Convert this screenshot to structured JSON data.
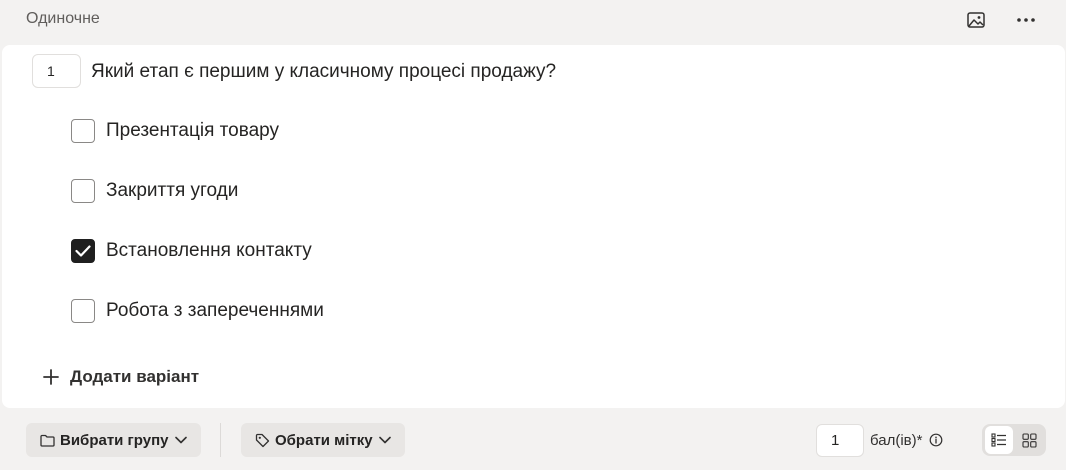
{
  "header": {
    "question_type": "Одиночне",
    "image_icon": "image-icon",
    "more_icon": "more-icon"
  },
  "question": {
    "number": "1",
    "text": "Який етап є першим у класичному процесі продажу?",
    "options": [
      {
        "label": "Презентація товару",
        "checked": false
      },
      {
        "label": "Закриття угоди",
        "checked": false
      },
      {
        "label": "Встановлення контакту",
        "checked": true
      },
      {
        "label": "Робота з запереченнями",
        "checked": false
      }
    ],
    "add_option_label": "Додати варіант"
  },
  "footer": {
    "group_label": "Вибрати групу",
    "tag_label": "Обрати мітку",
    "points_value": "1",
    "points_label": "бал(ів)*"
  }
}
